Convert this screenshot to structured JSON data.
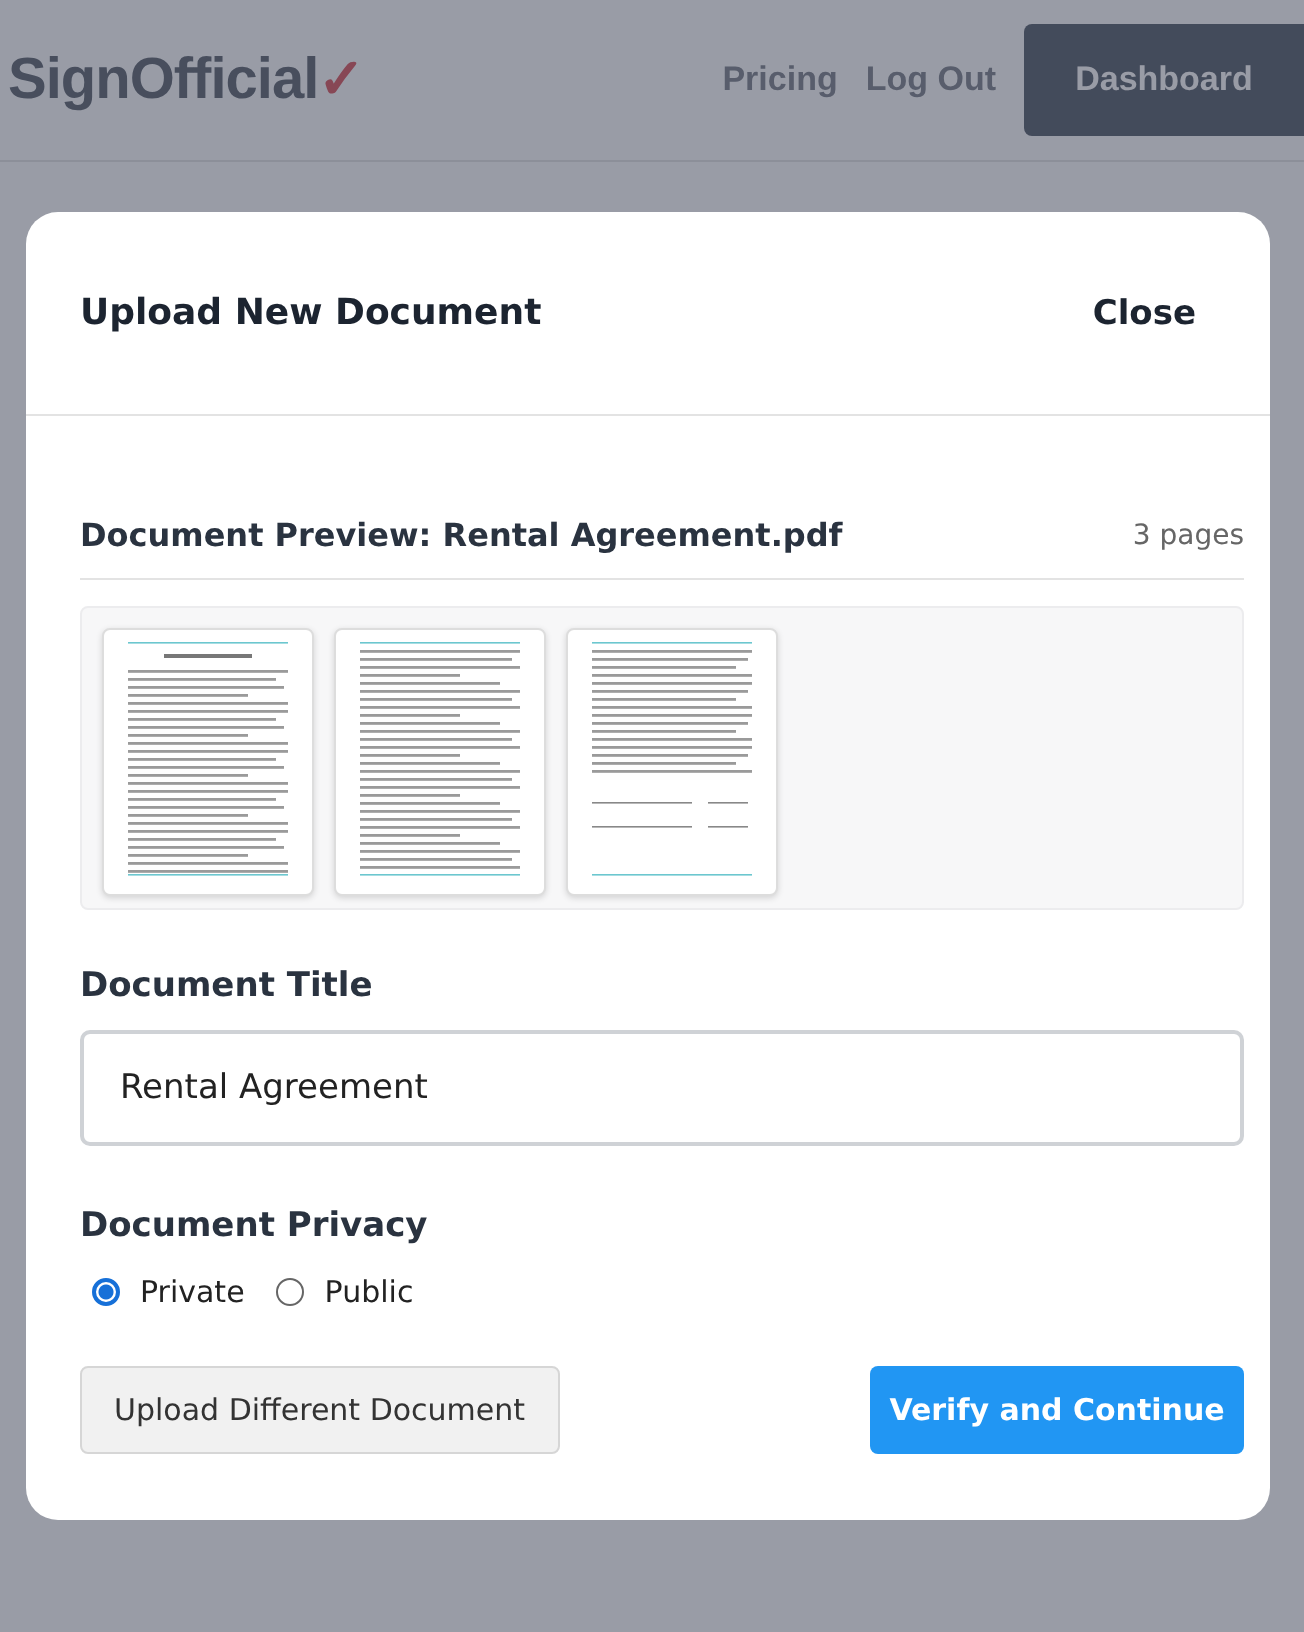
{
  "background": {
    "logo": {
      "text": "SignOfficial",
      "mark": "✓"
    },
    "nav": [
      "Pricing",
      "Log Out"
    ],
    "dashboard_button": "Dashboard"
  },
  "modal": {
    "title": "Upload New Document",
    "close": "Close",
    "preview": {
      "title": "Document Preview: Rental Agreement.pdf",
      "page_count": "3 pages",
      "pages": [
        {
          "kind": "cover"
        },
        {
          "kind": "body"
        },
        {
          "kind": "signature"
        }
      ]
    },
    "title_field": {
      "label": "Document Title",
      "value": "Rental Agreement"
    },
    "privacy": {
      "label": "Document Privacy",
      "options": [
        {
          "label": "Private",
          "selected": true
        },
        {
          "label": "Public",
          "selected": false
        }
      ]
    },
    "buttons": {
      "secondary": "Upload Different Document",
      "primary": "Verify and Continue"
    }
  }
}
